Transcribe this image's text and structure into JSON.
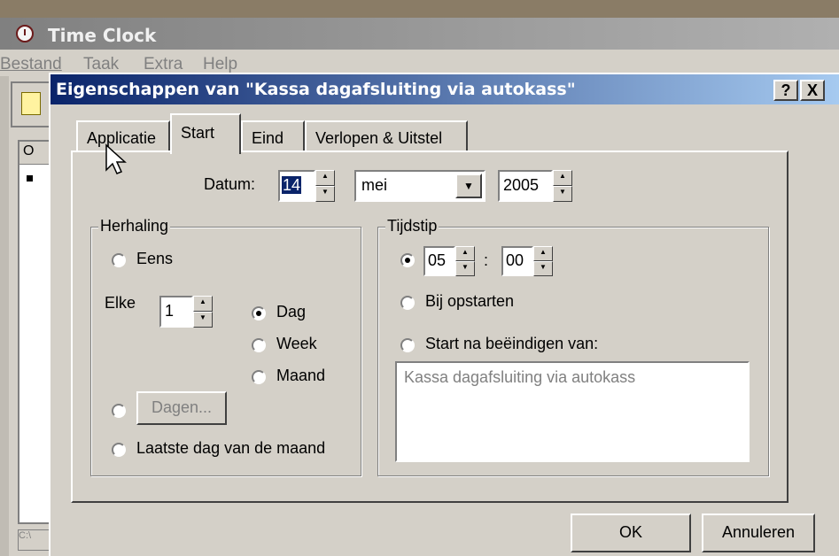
{
  "app": {
    "title": "Time Clock",
    "menu": [
      "Bestand",
      "Taak",
      "Extra",
      "Help"
    ],
    "list_header": "O",
    "status": "C:\\"
  },
  "dialog": {
    "title": "Eigenschappen van \"Kassa dagafsluiting via autokass\"",
    "help_btn": "?",
    "close_btn": "X",
    "tabs": [
      "Applicatie",
      "Start",
      "Eind",
      "Verlopen & Uitstel"
    ],
    "active_tab": "Start",
    "datum": {
      "label": "Datum:",
      "day": "14",
      "month": "mei",
      "year": "2005"
    },
    "herhaling": {
      "title": "Herhaling",
      "eens": "Eens",
      "elke_label": "Elke",
      "elke_value": "1",
      "dag": "Dag",
      "week": "Week",
      "maand": "Maand",
      "selected_unit": "Dag",
      "dagen_btn": "Dagen...",
      "laatste": "Laatste dag van de maand"
    },
    "tijdstip": {
      "title": "Tijdstip",
      "hour": "05",
      "sep": ":",
      "minute": "00",
      "bij_opstarten": "Bij opstarten",
      "start_na": "Start na beëindigen van:",
      "start_na_value": "Kassa dagafsluiting via autokass",
      "selected": "time"
    },
    "ok": "OK",
    "cancel": "Annuleren"
  }
}
